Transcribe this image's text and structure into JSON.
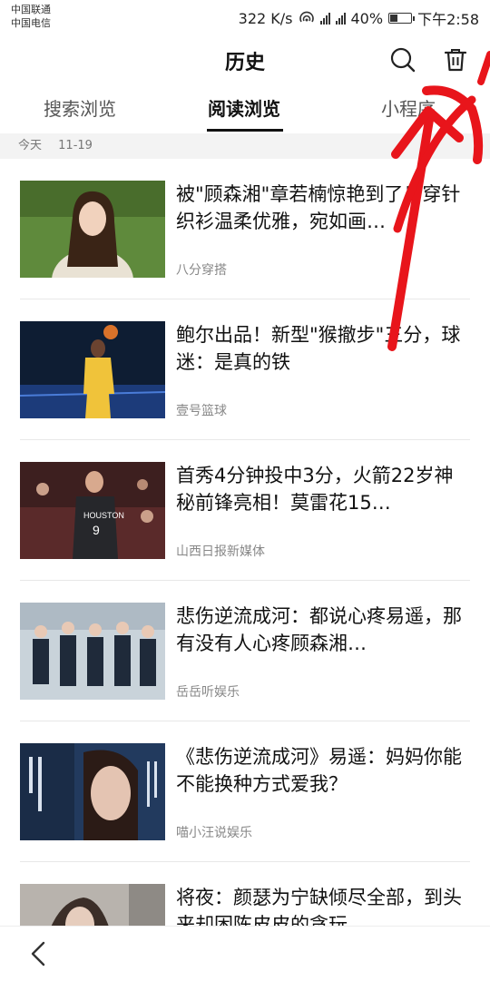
{
  "status": {
    "carrier1": "中国联通",
    "carrier2": "中国电信",
    "speed": "322 K/s",
    "battery": "40%",
    "time": "下午2:58",
    "battery_level": 0.4
  },
  "header": {
    "title": "历史"
  },
  "tabs": [
    {
      "label": "搜索浏览"
    },
    {
      "label": "阅读浏览"
    },
    {
      "label": "小程序"
    }
  ],
  "date_section": {
    "day": "今天",
    "date": "11-19"
  },
  "items": [
    {
      "title": "被\"顾森湘\"章若楠惊艳到了！穿针织衫温柔优雅，宛如画…",
      "source": "八分穿搭"
    },
    {
      "title": "鲍尔出品！新型\"猴撤步\"三分，球迷：是真的铁",
      "source": "壹号篮球"
    },
    {
      "title": "首秀4分钟投中3分，火箭22岁神秘前锋亮相！莫雷花15…",
      "source": "山西日报新媒体"
    },
    {
      "title": "悲伤逆流成河：都说心疼易遥，那有没有人心疼顾森湘…",
      "source": "岳岳听娱乐"
    },
    {
      "title": "《悲伤逆流成河》易遥：妈妈你能不能换种方式爱我？",
      "source": "喵小汪说娱乐"
    },
    {
      "title": "将夜：颜瑟为宁缺倾尽全部，到头来却困陈皮皮的贪玩",
      "source": ""
    }
  ],
  "colors": {
    "annotation_red": "#e8151b",
    "date_bar_bg": "#f3f3f3"
  }
}
